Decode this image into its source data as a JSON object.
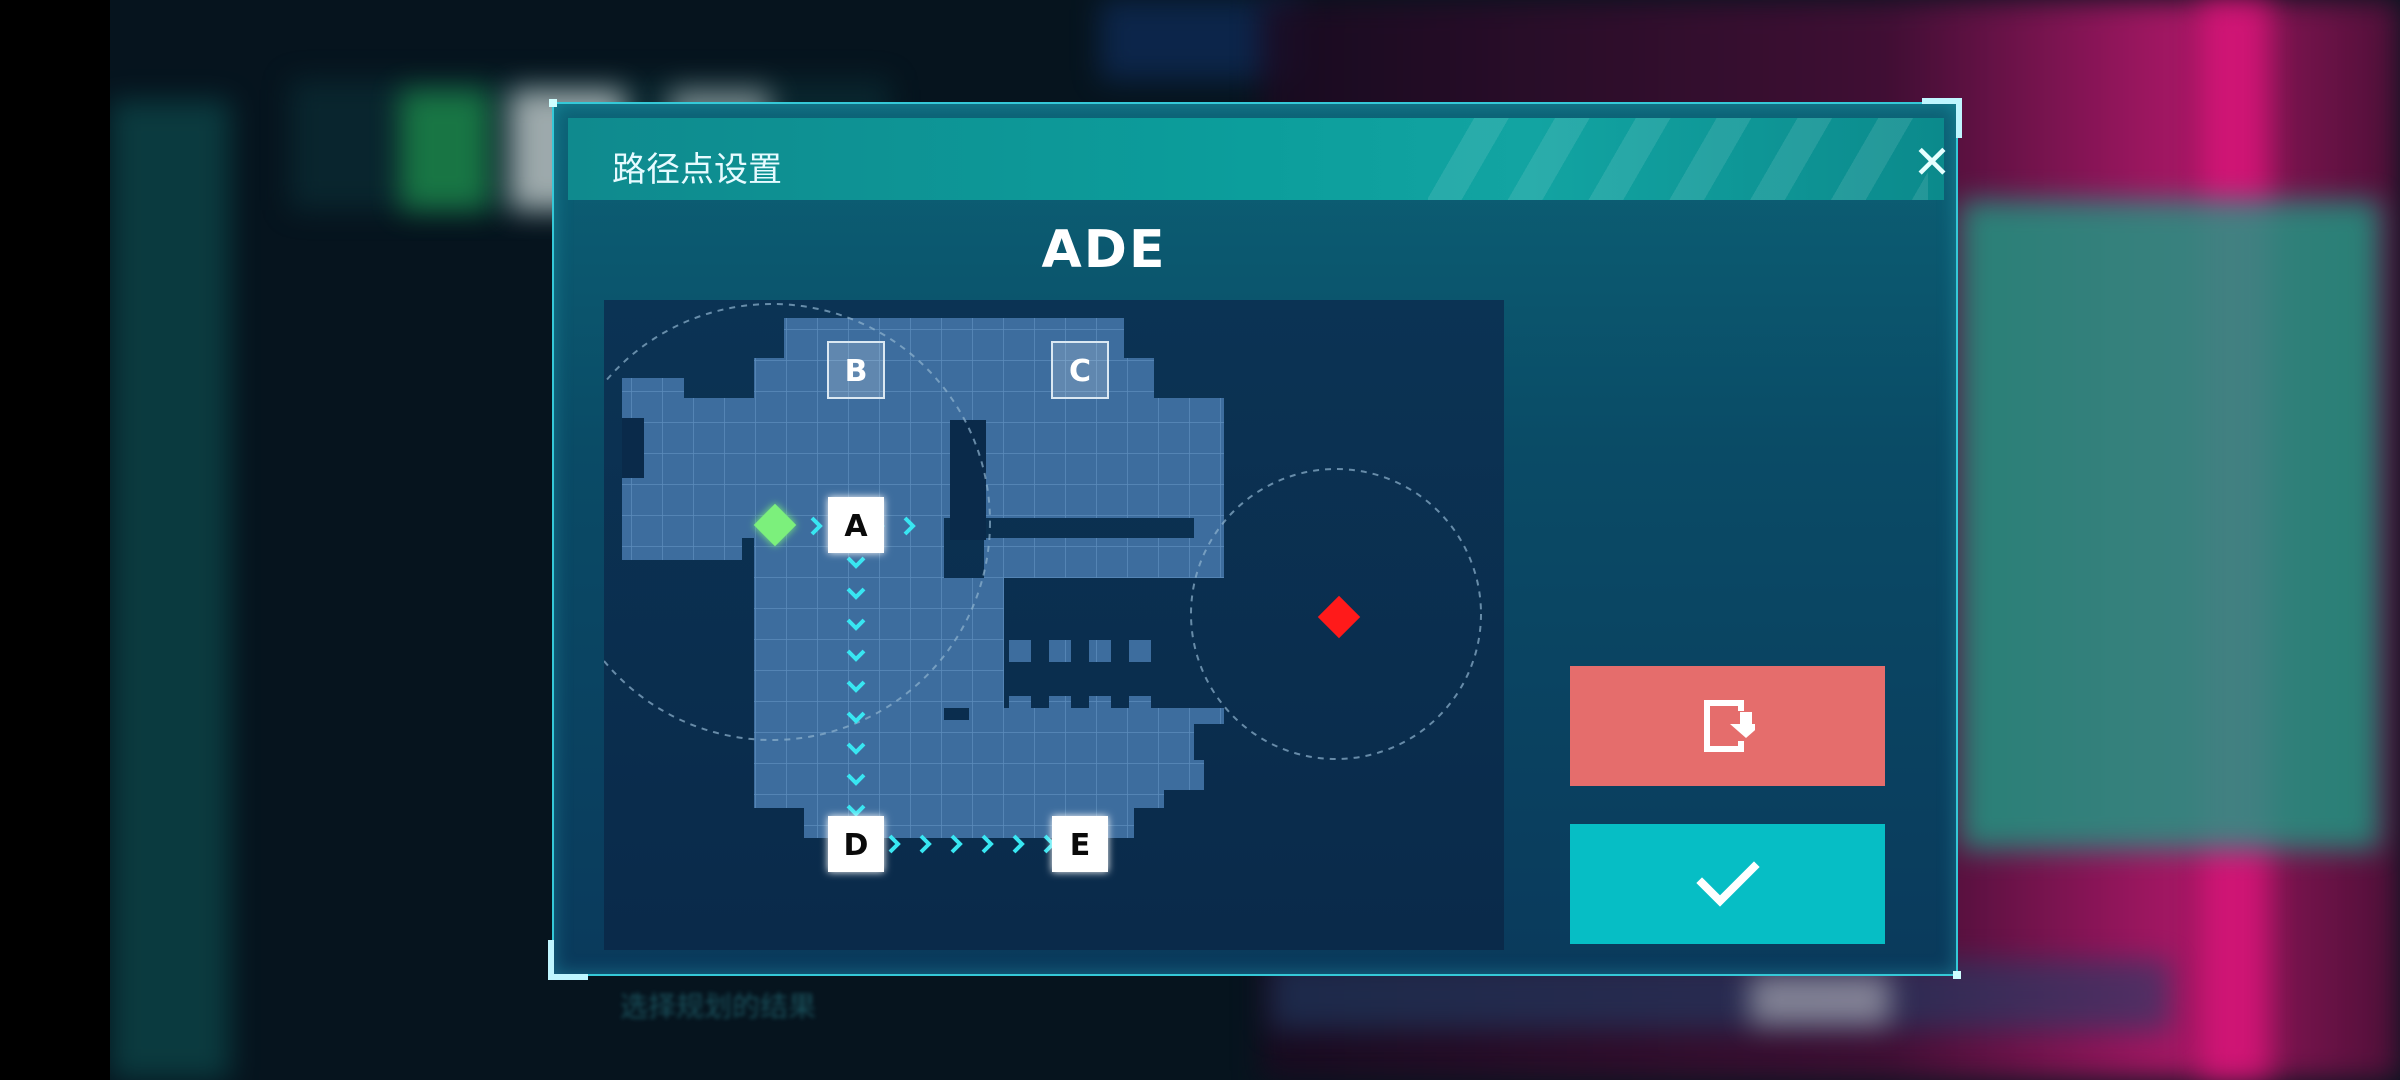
{
  "dialog": {
    "title": "路径点设置",
    "route_name": "ADE",
    "close_icon": "close-icon",
    "reset_icon": "reset-icon",
    "confirm_icon": "checkmark-icon",
    "colors": {
      "reset_button": "#e56d6c",
      "confirm_button": "#06bec5",
      "header": "#0c9e9c",
      "map_cell": "#3d6d9e",
      "path_arrow": "#38e6f2",
      "player_marker": "#7cf07c",
      "target_marker": "#ff1a1a"
    }
  },
  "map": {
    "waypoints": [
      {
        "label": "A",
        "active": true
      },
      {
        "label": "B",
        "active": false
      },
      {
        "label": "C",
        "active": false
      },
      {
        "label": "D",
        "active": true
      },
      {
        "label": "E",
        "active": true
      }
    ],
    "player_marker": "player-marker-icon",
    "target_marker": "target-marker-icon"
  },
  "background": {
    "hint_text": "选择规划的结果"
  }
}
